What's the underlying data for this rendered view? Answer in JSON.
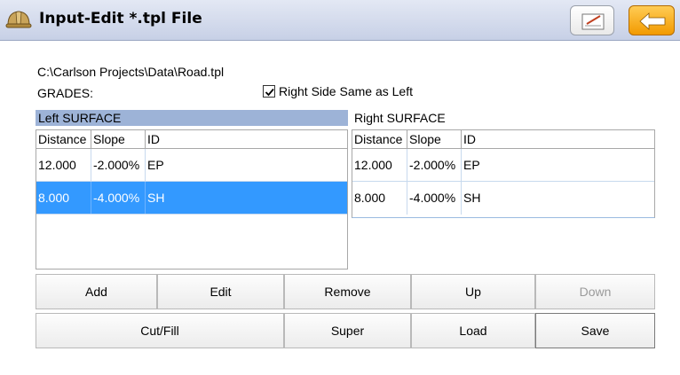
{
  "window": {
    "title": "Input-Edit *.tpl File",
    "icons": {
      "app": "hard-hat-icon",
      "sign": "signature-icon",
      "back": "back-arrow-icon"
    },
    "colors": {
      "titlebar": "#c7d0e6",
      "back_button": "#f29a00",
      "selection": "#3399ff",
      "left_header": "#9db3d7"
    }
  },
  "file_path": "C:\\Carlson Projects\\Data\\Road.tpl",
  "grades_label": "GRADES:",
  "right_same_as_left": {
    "label": "Right Side Same as Left",
    "checked": true
  },
  "left_surface": {
    "label": "Left SURFACE",
    "columns": [
      "Distance",
      "Slope",
      "ID"
    ],
    "rows": [
      {
        "distance": "12.000",
        "slope": "-2.000%",
        "id": "EP",
        "selected": false
      },
      {
        "distance": "8.000",
        "slope": "-4.000%",
        "id": "SH",
        "selected": true
      }
    ]
  },
  "right_surface": {
    "label": "Right SURFACE",
    "columns": [
      "Distance",
      "Slope",
      "ID"
    ],
    "rows": [
      {
        "distance": "12.000",
        "slope": "-2.000%",
        "id": "EP"
      },
      {
        "distance": "8.000",
        "slope": "-4.000%",
        "id": "SH"
      }
    ]
  },
  "buttons": {
    "add": "Add",
    "edit": "Edit",
    "remove": "Remove",
    "up": "Up",
    "down": "Down",
    "cut_fill": "Cut/Fill",
    "super": "Super",
    "load": "Load",
    "save": "Save"
  }
}
